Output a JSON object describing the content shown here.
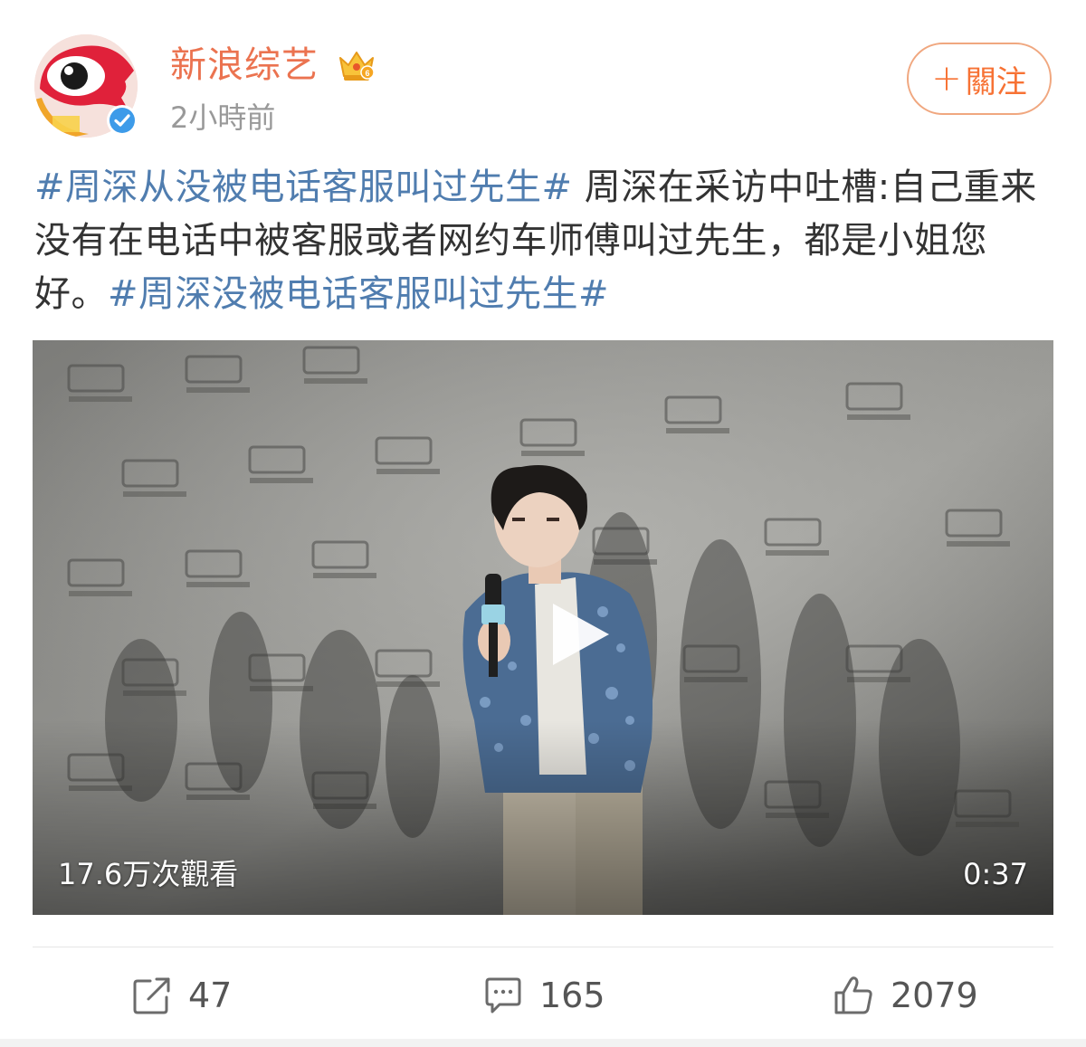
{
  "author": {
    "name": "新浪综艺",
    "avatar_label": "新浪",
    "time": "2小時前"
  },
  "follow_button": {
    "plus": "+",
    "label": "關注"
  },
  "post": {
    "hashtag_1": "#周深从没被电话客服叫过先生#",
    "body": " 周深在采访中吐槽:自己重来没有在电话中被客服或者网约车师傅叫过先生，都是小姐您好。",
    "hashtag_2": "#周深没被电话客服叫过先生#"
  },
  "video": {
    "views": "17.6万次觀看",
    "duration": "0:37"
  },
  "actions": {
    "repost_count": "47",
    "comment_count": "165",
    "like_count": "2079"
  },
  "colors": {
    "author_name": "#eb7350",
    "hashtag": "#507daf",
    "follow_border": "#f0a77f",
    "verified": "#3d9be9"
  },
  "icons": {
    "avatar": "sina-eye-logo-icon",
    "verified": "verified-check-icon",
    "crown": "crown-vip-icon",
    "play": "play-icon",
    "repost": "repost-icon",
    "comment": "comment-icon",
    "like": "thumbs-up-icon"
  }
}
